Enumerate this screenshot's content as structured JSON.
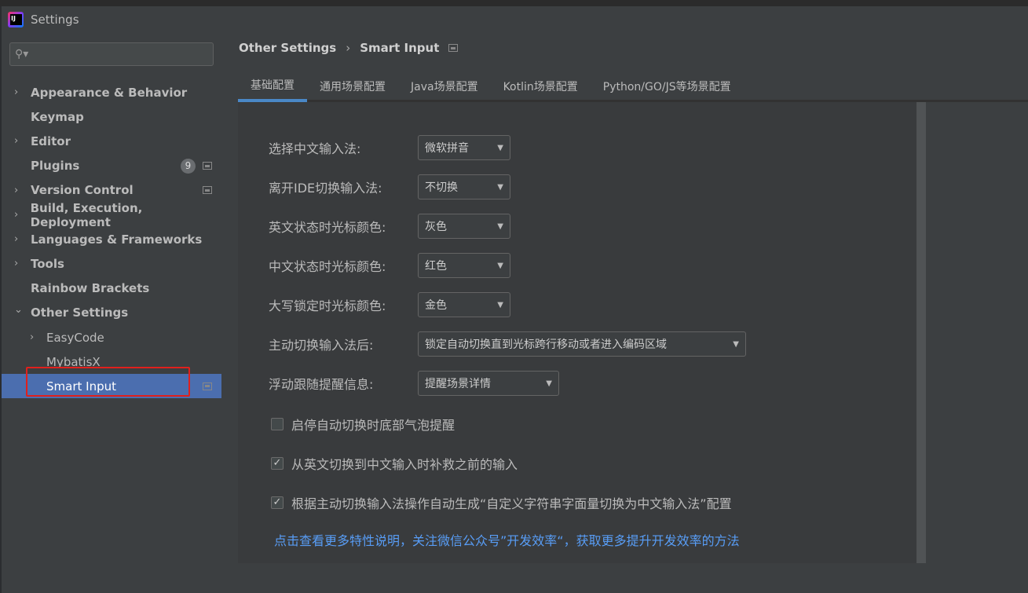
{
  "window": {
    "title": "Settings"
  },
  "search": {
    "placeholder": ""
  },
  "sidebar": {
    "items": [
      {
        "label": "Appearance & Behavior",
        "chevron": true,
        "bold": true
      },
      {
        "label": "Keymap",
        "chevron": false,
        "bold": true
      },
      {
        "label": "Editor",
        "chevron": true,
        "bold": true
      },
      {
        "label": "Plugins",
        "chevron": false,
        "bold": true,
        "badge": "9",
        "pin": true
      },
      {
        "label": "Version Control",
        "chevron": true,
        "bold": true,
        "pin": true
      },
      {
        "label": "Build, Execution, Deployment",
        "chevron": true,
        "bold": true
      },
      {
        "label": "Languages & Frameworks",
        "chevron": true,
        "bold": true
      },
      {
        "label": "Tools",
        "chevron": true,
        "bold": true
      },
      {
        "label": "Rainbow Brackets",
        "chevron": false,
        "bold": true
      },
      {
        "label": "Other Settings",
        "chevron": "open",
        "bold": true
      },
      {
        "label": "EasyCode",
        "chevron": true,
        "indent": true
      },
      {
        "label": "MybatisX",
        "chevron": false,
        "indent": true
      },
      {
        "label": "Smart Input",
        "chevron": false,
        "indent": true,
        "selected": true,
        "pin": true
      }
    ]
  },
  "breadcrumb": {
    "parent": "Other Settings",
    "current": "Smart Input"
  },
  "tabs": [
    {
      "label": "基础配置",
      "active": true
    },
    {
      "label": "通用场景配置"
    },
    {
      "label": "Java场景配置"
    },
    {
      "label": "Kotlin场景配置"
    },
    {
      "label": "Python/GO/JS等场景配置"
    }
  ],
  "form": {
    "rows": [
      {
        "label": "选择中文输入法:",
        "value": "微软拼音"
      },
      {
        "label": "离开IDE切换输入法:",
        "value": "不切换"
      },
      {
        "label": "英文状态时光标颜色:",
        "value": "灰色"
      },
      {
        "label": "中文状态时光标颜色:",
        "value": "红色"
      },
      {
        "label": "大写锁定时光标颜色:",
        "value": "金色"
      },
      {
        "label": "主动切换输入法后:",
        "value": "锁定自动切换直到光标跨行移动或者进入编码区域"
      },
      {
        "label": "浮动跟随提醒信息:",
        "value": "提醒场景详情"
      }
    ],
    "checkboxes": [
      {
        "label": "启停自动切换时底部气泡提醒",
        "checked": false
      },
      {
        "label": "从英文切换到中文输入时补救之前的输入",
        "checked": true
      },
      {
        "label": "根据主动切换输入法操作自动生成“自定义字符串字面量切换为中文输入法”配置",
        "checked": true
      }
    ],
    "link": "点击查看更多特性说明，关注微信公众号”开发效率“，获取更多提升开发效率的方法"
  },
  "colors": {
    "selection": "#4b6eaf",
    "highlight": "#e0201c",
    "link": "#589df6",
    "tab_underline": "#4a88c7"
  }
}
